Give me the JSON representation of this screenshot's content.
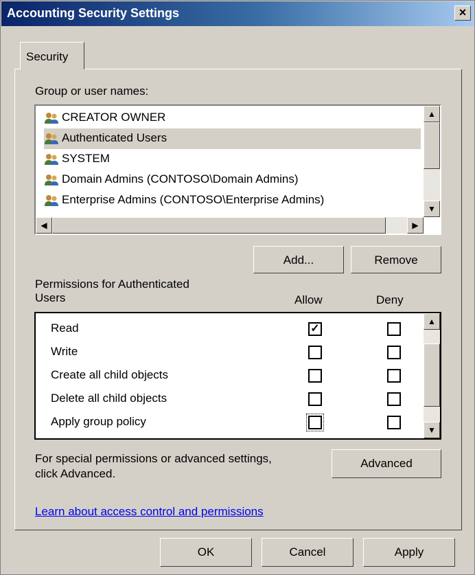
{
  "window": {
    "title": "Accounting Security Settings",
    "close_glyph": "×"
  },
  "tabs": [
    {
      "label": "Security"
    }
  ],
  "groups": {
    "label": "Group or user names:",
    "items": [
      {
        "name": "CREATOR OWNER",
        "icon": "group-users-icon"
      },
      {
        "name": "Authenticated Users",
        "icon": "group-users-icon"
      },
      {
        "name": "SYSTEM",
        "icon": "group-users-icon"
      },
      {
        "name": "Domain Admins (CONTOSO\\Domain Admins)",
        "icon": "group-users-icon"
      },
      {
        "name": "Enterprise Admins (CONTOSO\\Enterprise Admins)",
        "icon": "group-users-icon"
      }
    ],
    "selected_index": 1
  },
  "buttons": {
    "add": "Add...",
    "remove": "Remove",
    "advanced": "Advanced",
    "ok": "OK",
    "cancel": "Cancel",
    "apply": "Apply"
  },
  "permissions": {
    "label_line1": "Permissions for Authenticated",
    "label_line2": "Users",
    "allow_header": "Allow",
    "deny_header": "Deny",
    "rows": [
      {
        "name": "Read",
        "allow": true,
        "deny": false
      },
      {
        "name": "Write",
        "allow": false,
        "deny": false
      },
      {
        "name": "Create all child objects",
        "allow": false,
        "deny": false
      },
      {
        "name": "Delete all child objects",
        "allow": false,
        "deny": false
      },
      {
        "name": "Apply group policy",
        "allow": false,
        "deny": false
      }
    ]
  },
  "advanced_note": {
    "line1": "For special permissions or advanced settings,",
    "line2": "click Advanced."
  },
  "learn_link": "Learn about access control and permissions",
  "colors": {
    "title_bar_start": "#0a246a",
    "title_bar_end": "#a6caf0",
    "dialog_bg": "#d4d0c8",
    "selection_bg": "#d4d0c8",
    "link": "#0000ee"
  }
}
